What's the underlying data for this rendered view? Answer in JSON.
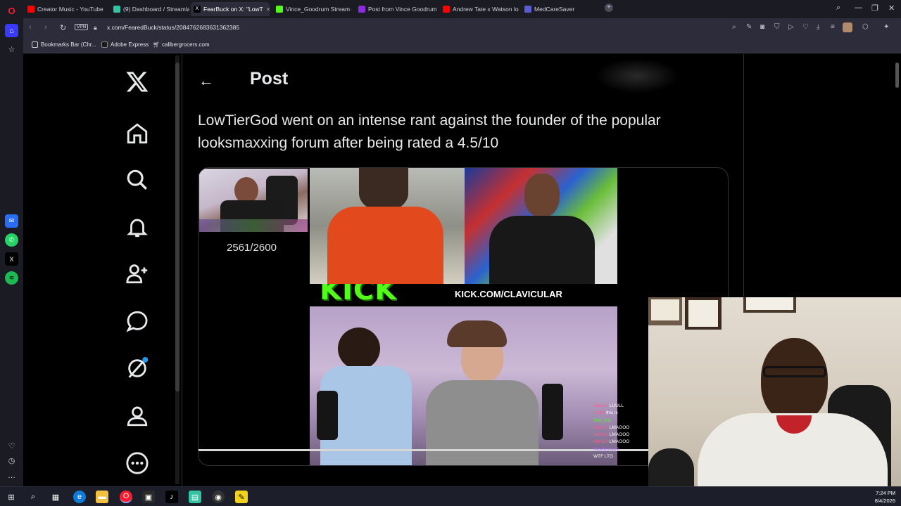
{
  "browser": {
    "tabs": [
      {
        "title": "Creator Music - YouTube S",
        "color": "#ff0000"
      },
      {
        "title": "(9) Dashboard / Streamlab",
        "color": "#31c3a2"
      },
      {
        "title": "FearBuck on X: \"LowT",
        "color": "#000000"
      },
      {
        "title": "Vince_Goodrum Stream -",
        "color": "#53fc18"
      },
      {
        "title": "Post from Vince Goodrum",
        "color": "#8a2be2"
      },
      {
        "title": "Andrew Tate x Watson loo",
        "color": "#ff0000"
      },
      {
        "title": "MedCareSaver",
        "color": "#5b5bd6"
      }
    ],
    "new_tab_glyph": "+",
    "vpn_label": "VPN",
    "url": "x.com/FearedBuck/status/2084762683631362385",
    "bookmarks": [
      {
        "label": "Bookmarks Bar (Chr...",
        "icon": "folder-icon"
      },
      {
        "label": "Adobe Express",
        "icon": "adobe-icon"
      },
      {
        "label": "calibergrocers.com",
        "icon": "cart-icon"
      }
    ]
  },
  "x": {
    "header_title": "Post",
    "tweet_text": "LowTierGod went on an intense rant against the founder of the popular looksmaxxing forum after being rated a 4.5/10",
    "media": {
      "rating_text": "2561/2600",
      "kick_logo": "KICK",
      "kick_url": "KICK.COM/CLAVICULAR",
      "progress": 0.85,
      "chat": [
        {
          "name": "slump0",
          "msg": "LUULL"
        },
        {
          "name": "ru19x",
          "msg": "this is"
        },
        {
          "name": "Sho_Kai",
          "msg": ""
        },
        {
          "name": "slump0",
          "msg": "LMAOOO"
        },
        {
          "name": "odhielo",
          "msg": "LMAOOO"
        },
        {
          "name": "slump0",
          "msg": "LMAOOO"
        },
        {
          "name": "NiceMoneyA",
          "msg": ""
        },
        {
          "name": "",
          "msg": "WTF LTG"
        }
      ]
    },
    "nav_icons": [
      "x-logo-icon",
      "home-icon",
      "search-icon",
      "bell-icon",
      "follow-icon",
      "messages-icon",
      "grok-icon",
      "profile-icon",
      "more-icon"
    ]
  },
  "taskbar": {
    "time": "7:24 PM",
    "date": "8/4/2026"
  }
}
